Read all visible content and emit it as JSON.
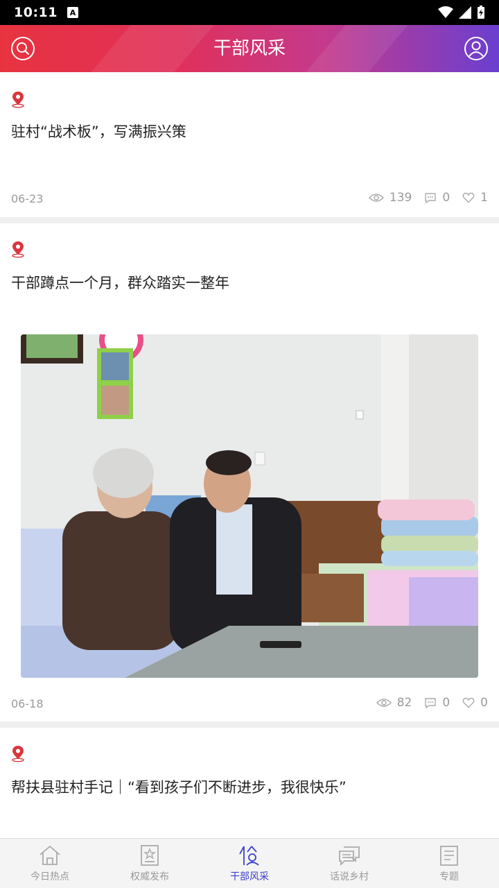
{
  "status": {
    "time": "10:11",
    "badge": "A"
  },
  "header": {
    "title": "干部风采"
  },
  "articles": [
    {
      "title": "驻村“战术板”，写满振兴策",
      "date": "06-23",
      "views": "139",
      "comments": "0",
      "likes": "1"
    },
    {
      "title": "干部蹲点一个月，群众踏实一整年",
      "date": "06-18",
      "views": "82",
      "comments": "0",
      "likes": "0"
    },
    {
      "title": "帮扶县驻村手记｜“看到孩子们不断进步，我很快乐”"
    }
  ],
  "tabs": [
    {
      "label": "今日热点",
      "icon": "house-icon"
    },
    {
      "label": "权威发布",
      "icon": "document-star-icon"
    },
    {
      "label": "干部风采",
      "icon": "cadre-icon",
      "active": true
    },
    {
      "label": "话说乡村",
      "icon": "chat-bubbles-icon"
    },
    {
      "label": "专题",
      "icon": "newspaper-icon"
    }
  ],
  "colors": {
    "accent_red": "#e8333f",
    "accent_purple": "#6a3fd0",
    "active_tab": "#3b3fc8",
    "pin": "#d9363e"
  }
}
